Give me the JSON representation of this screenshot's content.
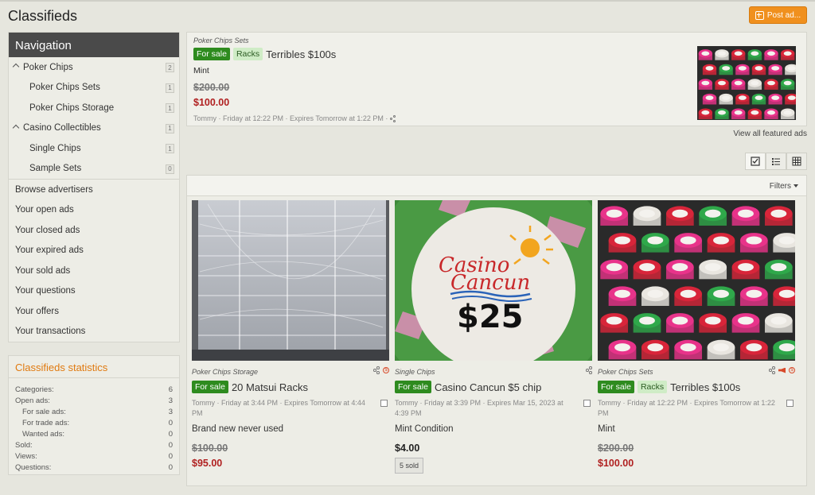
{
  "header": {
    "title": "Classifieds",
    "post_label": "Post ad..."
  },
  "nav": {
    "title": "Navigation",
    "categories": [
      {
        "label": "Poker Chips",
        "count": "2"
      },
      {
        "label": "Poker Chips Sets",
        "count": "1"
      },
      {
        "label": "Poker Chips Storage",
        "count": "1"
      },
      {
        "label": "Casino Collectibles",
        "count": "1"
      },
      {
        "label": "Single Chips",
        "count": "1"
      },
      {
        "label": "Sample Sets",
        "count": "0"
      }
    ],
    "links": [
      "Browse advertisers",
      "Your open ads",
      "Your closed ads",
      "Your expired ads",
      "Your sold ads",
      "Your questions",
      "Your offers",
      "Your transactions"
    ]
  },
  "stats": {
    "title": "Classifieds statistics",
    "rows": [
      {
        "label": "Categories:",
        "value": "6"
      },
      {
        "label": "Open ads:",
        "value": "3"
      },
      {
        "label": "For sale ads:",
        "value": "3"
      },
      {
        "label": "For trade ads:",
        "value": "0"
      },
      {
        "label": "Wanted ads:",
        "value": "0"
      },
      {
        "label": "Sold:",
        "value": "0"
      },
      {
        "label": "Views:",
        "value": "0"
      },
      {
        "label": "Questions:",
        "value": "0"
      }
    ]
  },
  "featured": {
    "category": "Poker Chips Sets",
    "tag_sale": "For sale",
    "tag_racks": "Racks",
    "title": "Terribles $100s",
    "condition": "Mint",
    "old_price": "$200.00",
    "price": "$100.00",
    "meta": "Tommy · Friday at 12:22 PM · Expires Tomorrow at 1:22 PM ·",
    "view_all": "View all featured ads"
  },
  "filters_label": "Filters",
  "chip_text": {
    "casino": "Casino",
    "cancun": "Cancun",
    "amount": "$25"
  },
  "cards": [
    {
      "category": "Poker Chips Storage",
      "tag_sale": "For sale",
      "title": "20 Matsui Racks",
      "meta": "Tommy · Friday at 3:44 PM · Expires Tomorrow at 4:44 PM",
      "desc": "Brand new never used",
      "old_price": "$100.00",
      "price": "$95.00"
    },
    {
      "category": "Single Chips",
      "tag_sale": "For sale",
      "title": "Casino Cancun $5 chip",
      "meta": "Tommy · Friday at 3:39 PM · Expires Mar 15, 2023 at 4:39 PM",
      "desc": "Mint Condition",
      "price": "$4.00",
      "sold": "5 sold"
    },
    {
      "category": "Poker Chips Sets",
      "tag_sale": "For sale",
      "tag_racks": "Racks",
      "title": "Terribles $100s",
      "meta": "Tommy · Friday at 12:22 PM · Expires Tomorrow at 1:22 PM",
      "desc": "Mint",
      "old_price": "$200.00",
      "price": "$100.00"
    }
  ]
}
